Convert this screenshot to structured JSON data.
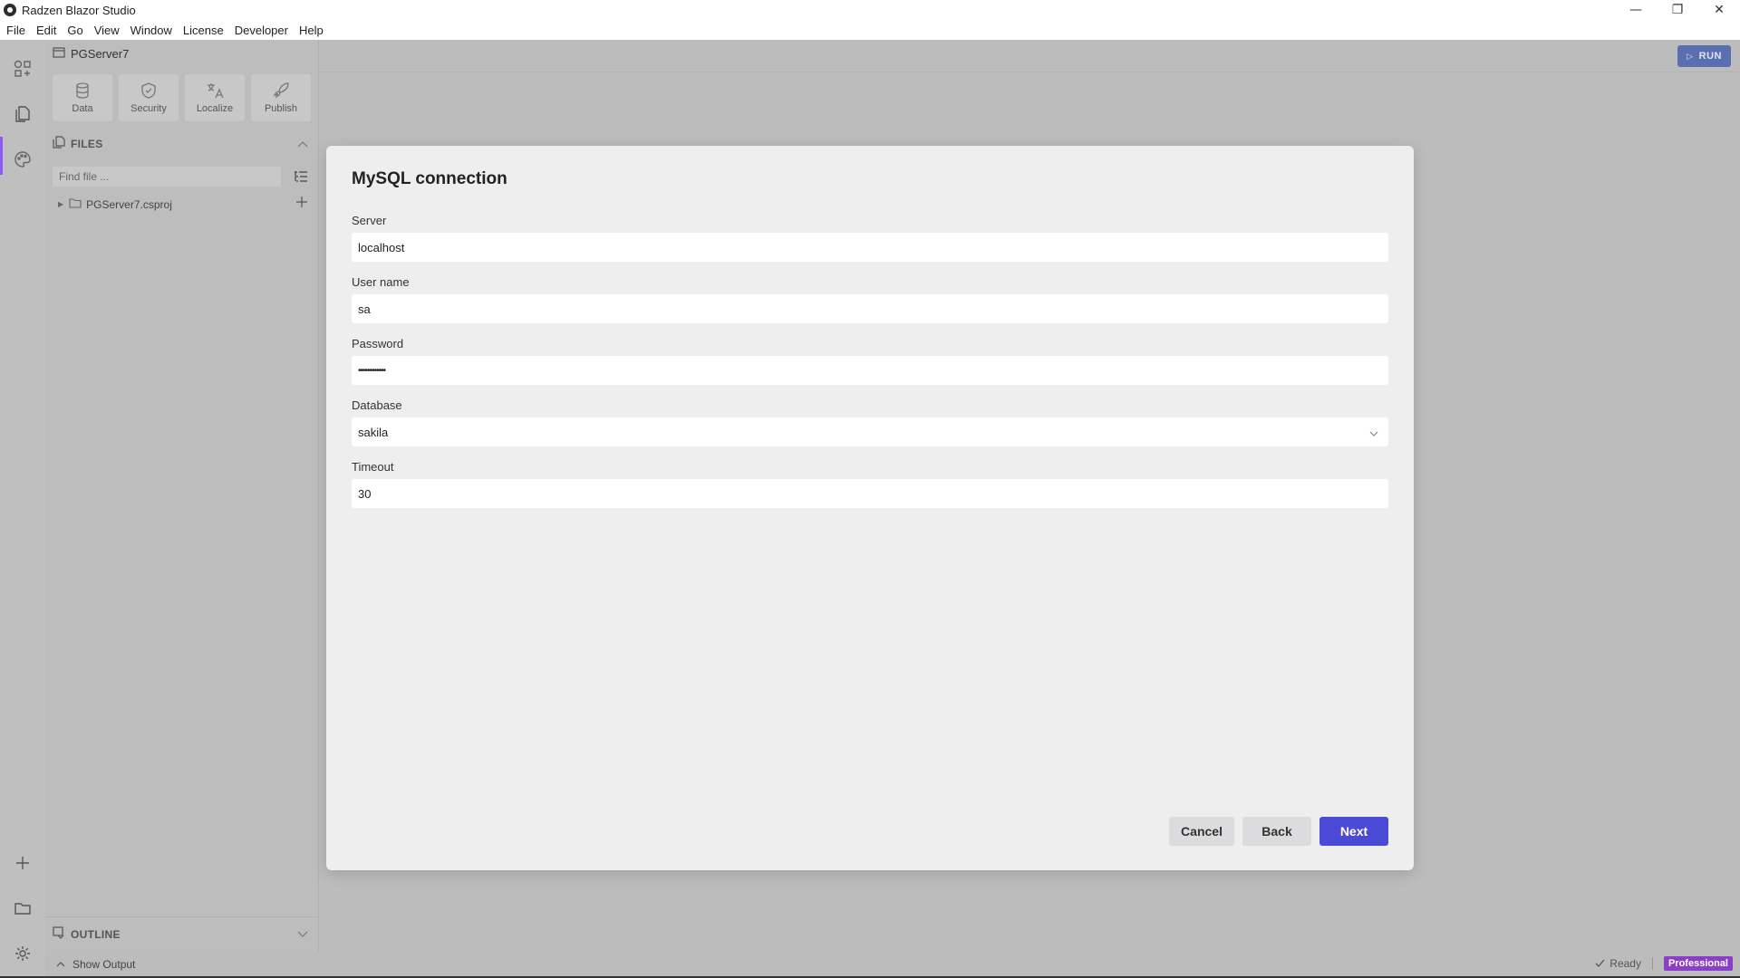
{
  "window": {
    "title": "Radzen Blazor Studio",
    "minimize": "—",
    "maximize": "❐",
    "close": "✕"
  },
  "menu": [
    "File",
    "Edit",
    "Go",
    "View",
    "Window",
    "License",
    "Developer",
    "Help"
  ],
  "activity_bar": {
    "items": [
      "components-icon",
      "files-icon",
      "palette-icon"
    ],
    "bottom": [
      "add-icon",
      "folder-icon",
      "gear-icon"
    ]
  },
  "sidepanel": {
    "project": "PGServer7",
    "tools": [
      {
        "label": "Data",
        "icon": "database-icon"
      },
      {
        "label": "Security",
        "icon": "shield-icon"
      },
      {
        "label": "Localize",
        "icon": "translate-icon"
      },
      {
        "label": "Publish",
        "icon": "rocket-icon"
      }
    ],
    "files_header": "FILES",
    "find_placeholder": "Find file ...",
    "tree": [
      {
        "label": "PGServer7.csproj"
      }
    ],
    "outline_header": "OUTLINE"
  },
  "main": {
    "run_label": "RUN"
  },
  "dialog": {
    "title": "MySQL connection",
    "fields": {
      "server": {
        "label": "Server",
        "value": "localhost"
      },
      "username": {
        "label": "User name",
        "value": "sa"
      },
      "password": {
        "label": "Password",
        "value": "••••••••••••"
      },
      "database": {
        "label": "Database",
        "value": "sakila"
      },
      "timeout": {
        "label": "Timeout",
        "value": "30"
      }
    },
    "buttons": {
      "cancel": "Cancel",
      "back": "Back",
      "next": "Next"
    }
  },
  "statusbar": {
    "show_output": "Show Output",
    "ready": "Ready",
    "edition": "Professional"
  },
  "colors": {
    "primary": "#4a4ad6",
    "accent": "#8b5cf6",
    "badge": "#8b3fc9",
    "run": "#5a6fb0"
  }
}
